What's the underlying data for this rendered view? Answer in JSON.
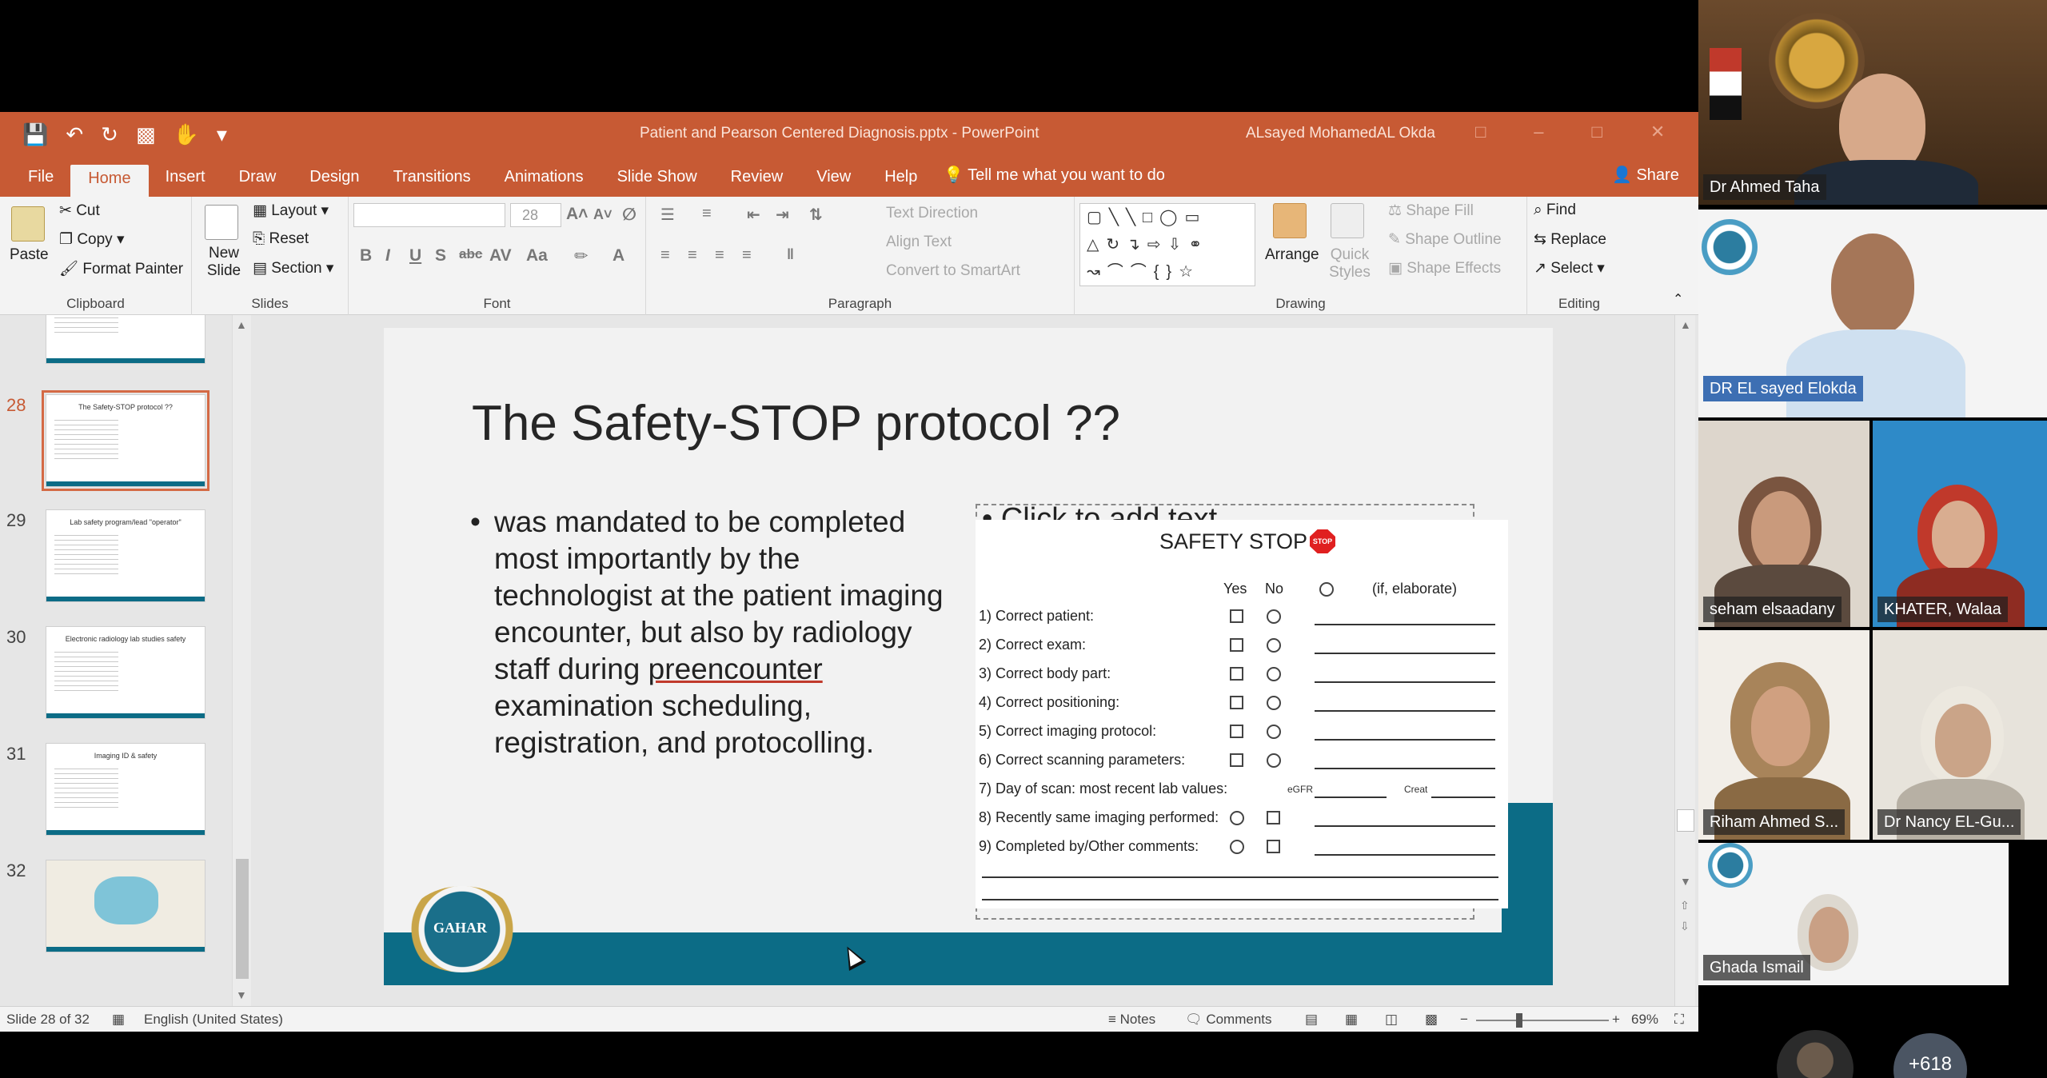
{
  "window": {
    "doc_title": "Patient and Pearson Centered Diagnosis.pptx  -  PowerPoint",
    "user_name": "ALsayed MohamedAL Okda"
  },
  "tabs": [
    "File",
    "Home",
    "Insert",
    "Draw",
    "Design",
    "Transitions",
    "Animations",
    "Slide Show",
    "Review",
    "View",
    "Help"
  ],
  "tell_me": "Tell me what you want to do",
  "share": "Share",
  "ribbon": {
    "clipboard": {
      "label": "Clipboard",
      "paste": "Paste",
      "cut": "Cut",
      "copy": "Copy",
      "format_painter": "Format Painter"
    },
    "slides": {
      "label": "Slides",
      "new_slide": "New Slide",
      "layout": "Layout",
      "reset": "Reset",
      "section": "Section"
    },
    "font": {
      "label": "Font",
      "size": "28"
    },
    "paragraph": {
      "label": "Paragraph",
      "text_direction": "Text Direction",
      "align_text": "Align Text",
      "convert_smartart": "Convert to SmartArt"
    },
    "drawing": {
      "label": "Drawing",
      "arrange": "Arrange",
      "quick_styles": "Quick Styles",
      "shape_fill": "Shape Fill",
      "shape_outline": "Shape Outline",
      "shape_effects": "Shape Effects"
    },
    "editing": {
      "label": "Editing",
      "find": "Find",
      "replace": "Replace",
      "select": "Select"
    }
  },
  "thumbnails": [
    {
      "num": "28",
      "title": "The Safety-STOP protocol ??",
      "selected": true
    },
    {
      "num": "29",
      "title": "Lab safety program/lead \"operator\""
    },
    {
      "num": "30",
      "title": "Electronic radiology lab studies safety"
    },
    {
      "num": "31",
      "title": "Imaging ID & safety"
    },
    {
      "num": "32",
      "title": ""
    }
  ],
  "slide": {
    "title": "The Safety-STOP protocol ??",
    "bullet_before": "was mandated to be completed most importantly by the technologist at the patient imaging encounter, but also by radiology staff during ",
    "bullet_underlined": "preencounter",
    "bullet_after": " examination scheduling, registration, and protocolling.",
    "placeholder": "• Click to add text",
    "logo_text": "GAHAR",
    "form": {
      "title": "SAFETY STOP",
      "stop_badge": "STOP",
      "col_yes": "Yes",
      "col_no": "No",
      "col_elaborate": "(if, elaborate)",
      "rows": [
        "1)  Correct patient:",
        "2)  Correct exam:",
        "3)  Correct body part:",
        "4)  Correct positioning:",
        "5)  Correct imaging protocol:",
        "6)  Correct scanning parameters:",
        "7)  Day of scan: most recent lab values:",
        "8)  Recently same imaging performed:",
        "9)  Completed by/Other comments:"
      ],
      "egfr": "eGFR",
      "creat": "Creat"
    }
  },
  "status": {
    "slide_of": "Slide 28 of 32",
    "language": "English (United States)",
    "notes": "Notes",
    "comments": "Comments",
    "zoom": "69%"
  },
  "participants": [
    {
      "name": "Dr Ahmed Taha"
    },
    {
      "name": "DR EL sayed Elokda"
    },
    {
      "name": "seham elsaadany"
    },
    {
      "name": "KHATER, Walaa"
    },
    {
      "name": "Riham Ahmed S..."
    },
    {
      "name": "Dr Nancy EL-Gu..."
    },
    {
      "name": "Ghada Ismail"
    }
  ],
  "more_participants": "+618"
}
